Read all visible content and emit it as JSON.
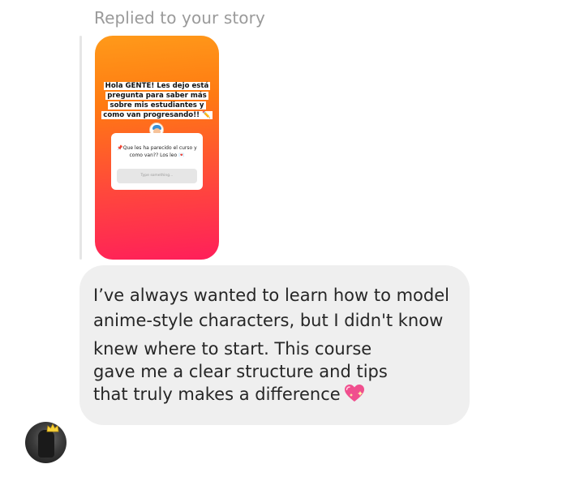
{
  "header": {
    "replied_label": "Replied to your story"
  },
  "story": {
    "headline": "Hola GENTE! Les dejo está pregunta para saber más sobre mis estudiantes y como van progresando!! ✏️",
    "question": "📌Que les ha parecido el curso y como van?? Los leo 💌",
    "input_placeholder": "Type something..."
  },
  "message": {
    "line1": "I’ve always wanted to learn how to model",
    "line2": "anime-style characters, but I didn't know",
    "line3": "knew where to start. This course",
    "line4": "gave me a clear structure and tips",
    "line5": "that truly makes a difference",
    "emoji": "sparkling-heart-icon"
  },
  "colors": {
    "bubble": "#efefef",
    "text": "#262626",
    "muted": "#9a9a9a",
    "story_gradient": [
      "#ff9a1a",
      "#ff7a12",
      "#ff4a3a",
      "#ff1f5a"
    ]
  }
}
